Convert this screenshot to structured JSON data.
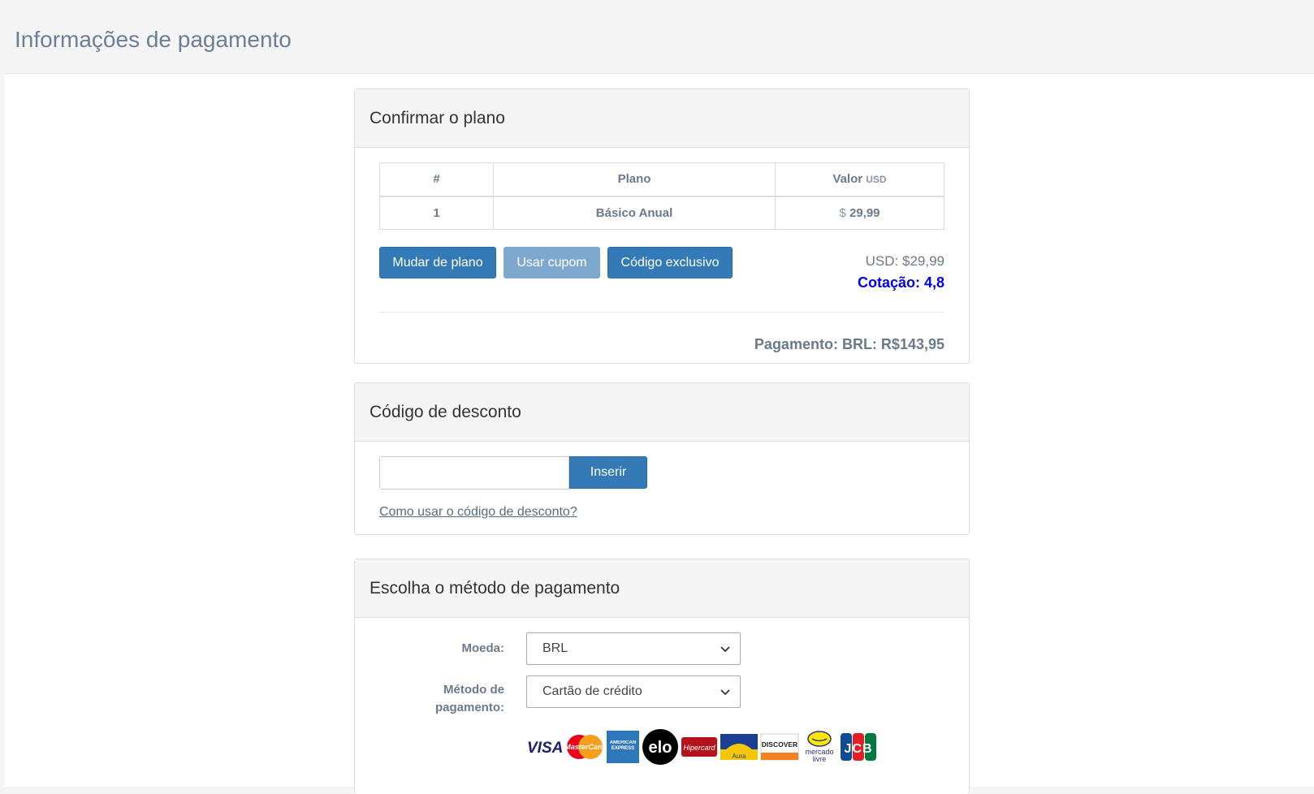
{
  "page": {
    "title": "Informações de pagamento"
  },
  "plan_panel": {
    "heading": "Confirmar o plano",
    "table": {
      "headers": {
        "num": "#",
        "plan": "Plano",
        "value": "Valor",
        "value_unit": "USD"
      },
      "rows": [
        {
          "num": "1",
          "plan": "Básico Anual",
          "currency": "$",
          "value": "29,99"
        }
      ]
    },
    "buttons": {
      "change_plan": "Mudar de plano",
      "use_coupon": "Usar cupom",
      "exclusive_code": "Código exclusivo"
    },
    "usd_total": "USD: $29,99",
    "rate": "Cotação: 4,8",
    "payment_total": "Pagamento: BRL: R$143,95"
  },
  "discount_panel": {
    "heading": "Código de desconto",
    "input_value": "",
    "insert_button": "Inserir",
    "help_link": "Como usar o código de desconto?"
  },
  "method_panel": {
    "heading": "Escolha o método de pagamento",
    "currency_label": "Moeda:",
    "currency_value": "BRL",
    "method_label_line1": "Método de",
    "method_label_line2": "pagamento:",
    "method_value": "Cartão de crédito",
    "card_brands": {
      "visa": "VISA",
      "mastercard": "MasterCard",
      "amex": "AMERICAN EXPRESS",
      "elo": "elo",
      "hipercard": "Hipercard",
      "aura": "Aura",
      "discover": "DISCOVER",
      "mercadolivre_1": "mercado",
      "mercadolivre_2": "livre",
      "jcb": "JCB"
    }
  },
  "colors": {
    "primary": "#337ab7",
    "primary_light": "#7fa8cf",
    "rate": "#0000ee",
    "muted": "#6b7a8b"
  }
}
